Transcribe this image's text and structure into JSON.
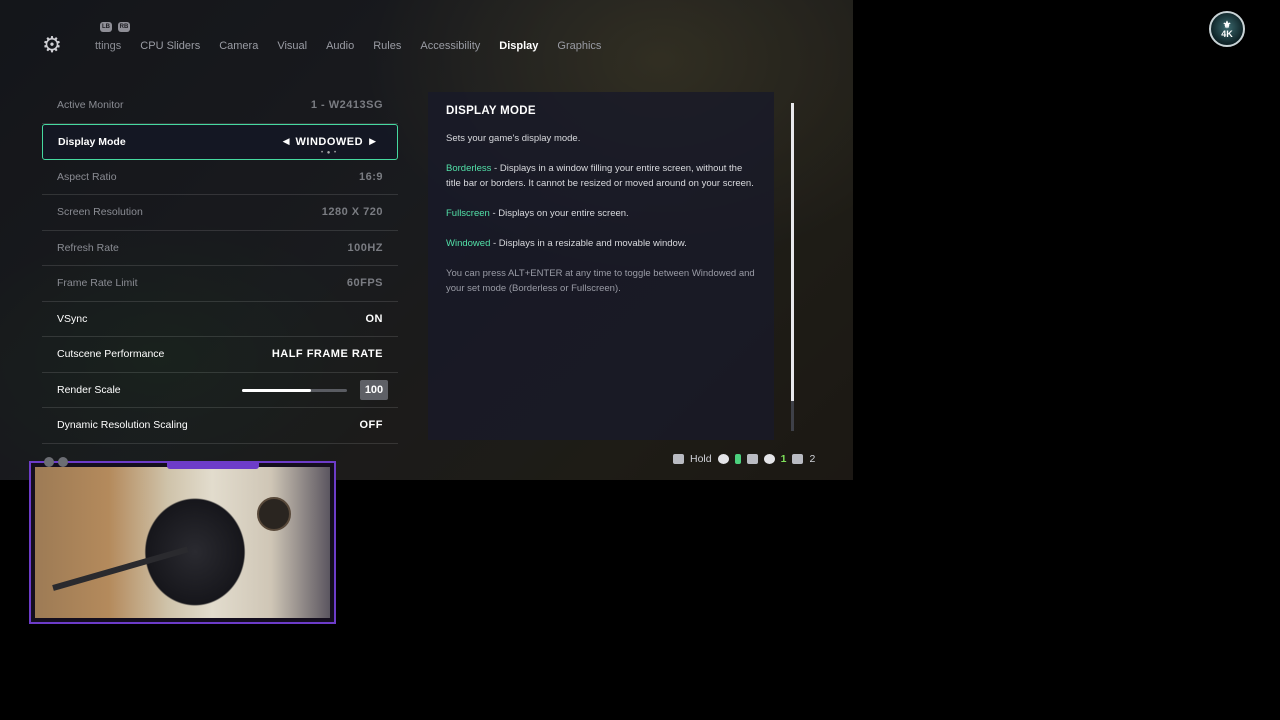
{
  "tabs": [
    {
      "label": "ttings",
      "active": false
    },
    {
      "label": "CPU Sliders",
      "active": false
    },
    {
      "label": "Camera",
      "active": false
    },
    {
      "label": "Visual",
      "active": false
    },
    {
      "label": "Audio",
      "active": false
    },
    {
      "label": "Rules",
      "active": false
    },
    {
      "label": "Accessibility",
      "active": false
    },
    {
      "label": "Display",
      "active": true
    },
    {
      "label": "Graphics",
      "active": false
    }
  ],
  "bumpers": {
    "left": "LB",
    "right": "RB"
  },
  "settings": [
    {
      "label": "Active Monitor",
      "value": "1 - W2413SG",
      "dim": true
    },
    {
      "label": "Display Mode",
      "value": "WINDOWED",
      "selected": true
    },
    {
      "label": "Aspect Ratio",
      "value": "16:9",
      "dim": true
    },
    {
      "label": "Screen Resolution",
      "value": "1280 X 720",
      "dim": true
    },
    {
      "label": "Refresh Rate",
      "value": "100HZ",
      "dim": true
    },
    {
      "label": "Frame Rate Limit",
      "value": "60FPS",
      "dim": true
    },
    {
      "label": "VSync",
      "value": "ON"
    },
    {
      "label": "Cutscene Performance",
      "value": "HALF FRAME RATE"
    },
    {
      "label": "Render Scale",
      "value": "100",
      "slider_fraction": 0.66
    },
    {
      "label": "Dynamic Resolution Scaling",
      "value": "OFF"
    }
  ],
  "info": {
    "title": "DISPLAY MODE",
    "intro": "Sets your game's display mode.",
    "borderless_term": "Borderless",
    "borderless_desc": " - Displays in a window filling your entire screen, without the title bar or borders. It cannot be resized or moved around on your screen.",
    "fullscreen_term": "Fullscreen",
    "fullscreen_desc": " - Displays on your entire screen.",
    "windowed_term": "Windowed",
    "windowed_desc": " - Displays in a resizable and movable window.",
    "tip": "You can press ALT+ENTER at any time to toggle between Windowed and your set mode (Borderless or Fullscreen)."
  },
  "footer": {
    "hold_label": "Hold",
    "count_green": "1",
    "players_count": "2"
  },
  "badge": {
    "text": "4K"
  },
  "colors": {
    "accent": "#46d9a0",
    "cam_border": "#6d3cc9"
  }
}
